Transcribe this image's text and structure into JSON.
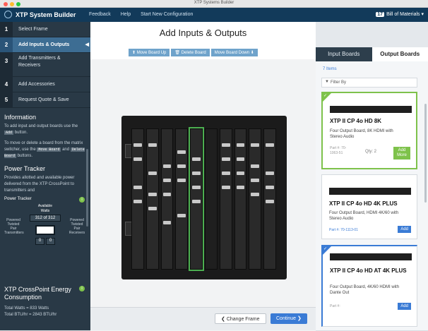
{
  "window": {
    "title": "XTP Systems Builder"
  },
  "navbar": {
    "brand": "XTP System Builder",
    "links": [
      "Feedback",
      "Help",
      "Start New Configuration"
    ],
    "bom_count": "17",
    "bom_label": "Bill of Materials"
  },
  "steps": [
    {
      "num": "1",
      "label": "Select Frame"
    },
    {
      "num": "2",
      "label": "Add Inputs & Outputs"
    },
    {
      "num": "3",
      "label": "Add Transmitters & Receivers"
    },
    {
      "num": "4",
      "label": "Add Accessories"
    },
    {
      "num": "5",
      "label": "Request Quote & Save"
    }
  ],
  "info": {
    "heading": "Information",
    "p1_a": "To add input and output boards use the",
    "p1_code": "Add",
    "p1_b": "button.",
    "p2_a": "To move or delete a board from the matrix switcher, use the",
    "p2_code1": "Move Board",
    "p2_mid": "and",
    "p2_code2": "Delete Board",
    "p2_b": "buttons.",
    "tracker_heading": "Power Tracker",
    "p3": "Provides allotted and available power delivered from the XTP CrossPoint to transmitters and"
  },
  "tracker": {
    "title": "Power Tracker",
    "available": "Available",
    "watts": "Watts",
    "value": "312 of 312",
    "left_label": "Powered Twisted Pair Transmitters",
    "right_label": "Powered Twisted Pair Receivers",
    "left_count": "0",
    "right_count": "0"
  },
  "energy": {
    "title": "XTP CrossPoint Energy Consumption",
    "total_watts": "Total Watts = 833 Watts",
    "total_btu": "Total BTU/hr = 2843 BTU/hr"
  },
  "main": {
    "title": "Add Inputs & Outputs",
    "toolbar": [
      "Move Board Up",
      "Delete Board",
      "Move Board Down"
    ],
    "change_frame": "Change Frame",
    "continue": "Continue"
  },
  "right": {
    "tabs": [
      "Input Boards",
      "Output Boards"
    ],
    "items_count": "7 Items",
    "filter": "Filter By",
    "cards": [
      {
        "title": "XTP II CP 4o HD 8K",
        "desc": "Four Output Board, 8K HDMI with Stereo Audio",
        "part": "Part #: 70-1063-51",
        "qty": "Qty: 2",
        "btn": "Add More"
      },
      {
        "title": "XTP II CP 4o HD 4K PLUS",
        "desc": "Four Output Board, HDMI 4K/60 with Stereo Audio",
        "part": "Part #: 70-1113-01",
        "btn": "Add"
      },
      {
        "title": "XTP II CP 4o HD AT 4K PLUS",
        "desc": "Four Output Board, 4K/60 HDMI with Dante Out",
        "part": "Part #:",
        "btn": "Add"
      }
    ]
  },
  "colors": {
    "navbar": "#123a5a",
    "sidebar": "#293946",
    "active_step": "#3d6d93",
    "accent_green": "#7ec24b",
    "button_blue": "#3a7bd5"
  }
}
